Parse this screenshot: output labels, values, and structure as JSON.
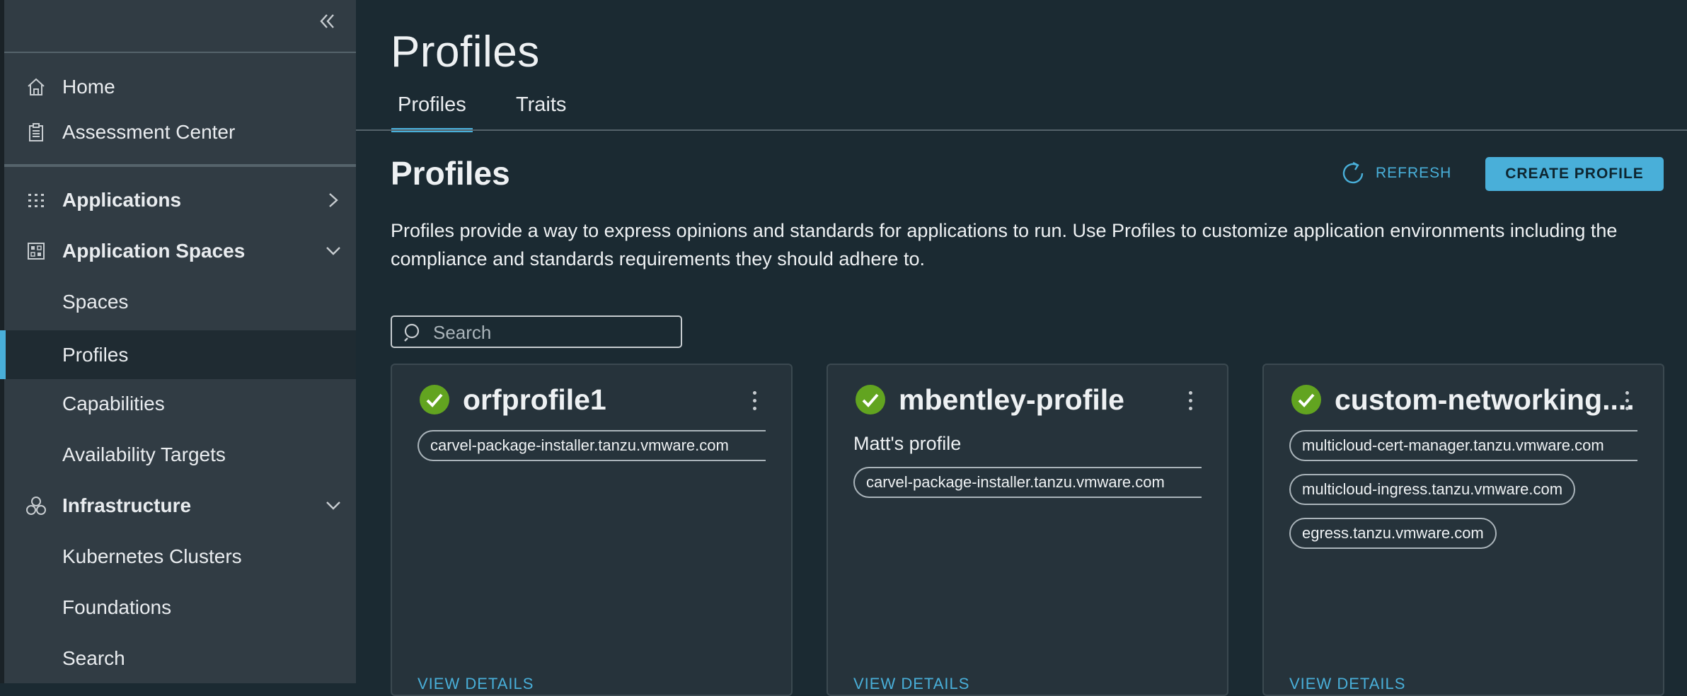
{
  "colors": {
    "accent": "#49afd9",
    "success": "#62a420",
    "sidebar_bg": "#313c44",
    "main_bg": "#1b2a32",
    "card_bg": "#26333b"
  },
  "sidebar": {
    "collapse_icon": "double-chevron-left-icon",
    "items": [
      {
        "label": "Home",
        "icon": "home-icon"
      },
      {
        "label": "Assessment Center",
        "icon": "clipboard-icon"
      },
      {
        "label": "Applications",
        "icon": "grid-dots-icon",
        "arrow": "chevron-right-icon"
      },
      {
        "label": "Application Spaces",
        "icon": "spaces-grid-icon",
        "arrow": "chevron-down-icon"
      },
      {
        "label": "Spaces"
      },
      {
        "label": "Profiles",
        "active": true
      },
      {
        "label": "Capabilities"
      },
      {
        "label": "Availability Targets"
      },
      {
        "label": "Infrastructure",
        "icon": "infrastructure-icon",
        "arrow": "chevron-down-icon"
      },
      {
        "label": "Kubernetes Clusters"
      },
      {
        "label": "Foundations"
      },
      {
        "label": "Search"
      }
    ]
  },
  "header": {
    "title": "Profiles",
    "tabs": [
      {
        "label": "Profiles",
        "active": true
      },
      {
        "label": "Traits"
      }
    ]
  },
  "section": {
    "title": "Profiles",
    "refresh_label": "REFRESH",
    "create_label": "CREATE PROFILE",
    "description": "Profiles provide a way to express opinions and standards for applications to run. Use Profiles to customize application environments including the compliance and standards requirements they should adhere to."
  },
  "search": {
    "placeholder": "Search",
    "value": ""
  },
  "cards": [
    {
      "title": "orfprofile1",
      "status_icon": "check-circle-icon",
      "description": "",
      "traits": [
        "carvel-package-installer.tanzu.vmware.com"
      ],
      "link": "VIEW DETAILS"
    },
    {
      "title": "mbentley-profile",
      "status_icon": "check-circle-icon",
      "description": "Matt's profile",
      "traits": [
        "carvel-package-installer.tanzu.vmware.com"
      ],
      "link": "VIEW DETAILS"
    },
    {
      "title": "custom-networking....",
      "status_icon": "check-circle-icon",
      "description": "",
      "traits": [
        "multicloud-cert-manager.tanzu.vmware.com",
        "multicloud-ingress.tanzu.vmware.com",
        "egress.tanzu.vmware.com"
      ],
      "link": "VIEW DETAILS"
    }
  ]
}
